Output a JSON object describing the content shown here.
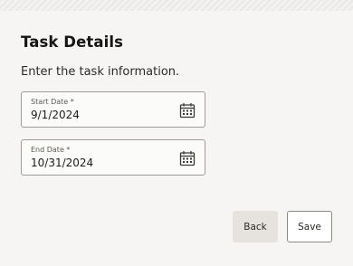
{
  "form": {
    "title": "Task Details",
    "instructions": "Enter the task information.",
    "start_date": {
      "label": "Start Date *",
      "value": "9/1/2024",
      "icon": "calendar-icon"
    },
    "end_date": {
      "label": "End Date *",
      "value": "10/31/2024",
      "icon": "calendar-icon"
    }
  },
  "actions": {
    "back_label": "Back",
    "save_label": "Save"
  }
}
